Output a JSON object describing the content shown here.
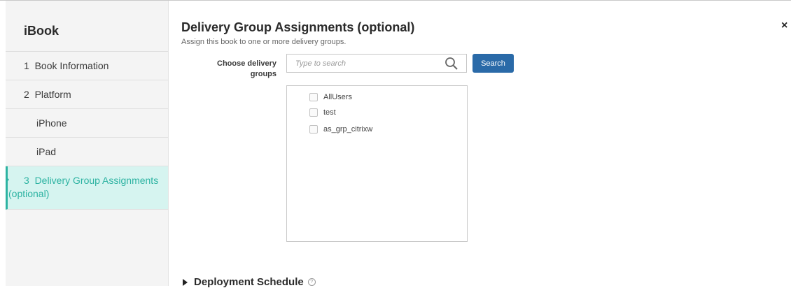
{
  "sidebar": {
    "title": "iBook",
    "items": [
      {
        "label": "1  Book Information"
      },
      {
        "label": "2  Platform"
      },
      {
        "label": "iPhone"
      },
      {
        "label": "iPad"
      },
      {
        "label_line1": "3  Delivery Group Assignments",
        "label_line2": "(optional)"
      }
    ]
  },
  "main": {
    "title": "Delivery Group Assignments (optional)",
    "subtitle": "Assign this book to one or more delivery groups.",
    "close_glyph": "×",
    "choose_label_line1": "Choose delivery",
    "choose_label_line2": "groups",
    "search": {
      "placeholder": "Type to search",
      "value": "",
      "button_label": "Search"
    },
    "groups": [
      {
        "label": "AllUsers",
        "checked": false
      },
      {
        "label": "test",
        "checked": false
      },
      {
        "label": "as_grp_citrixw",
        "checked": false
      }
    ],
    "deployment_schedule": {
      "title": "Deployment Schedule",
      "help_glyph": "?"
    }
  },
  "colors": {
    "accent": "#2db3a2",
    "active_bg": "#d6f4f0",
    "button": "#2a6aa8"
  }
}
